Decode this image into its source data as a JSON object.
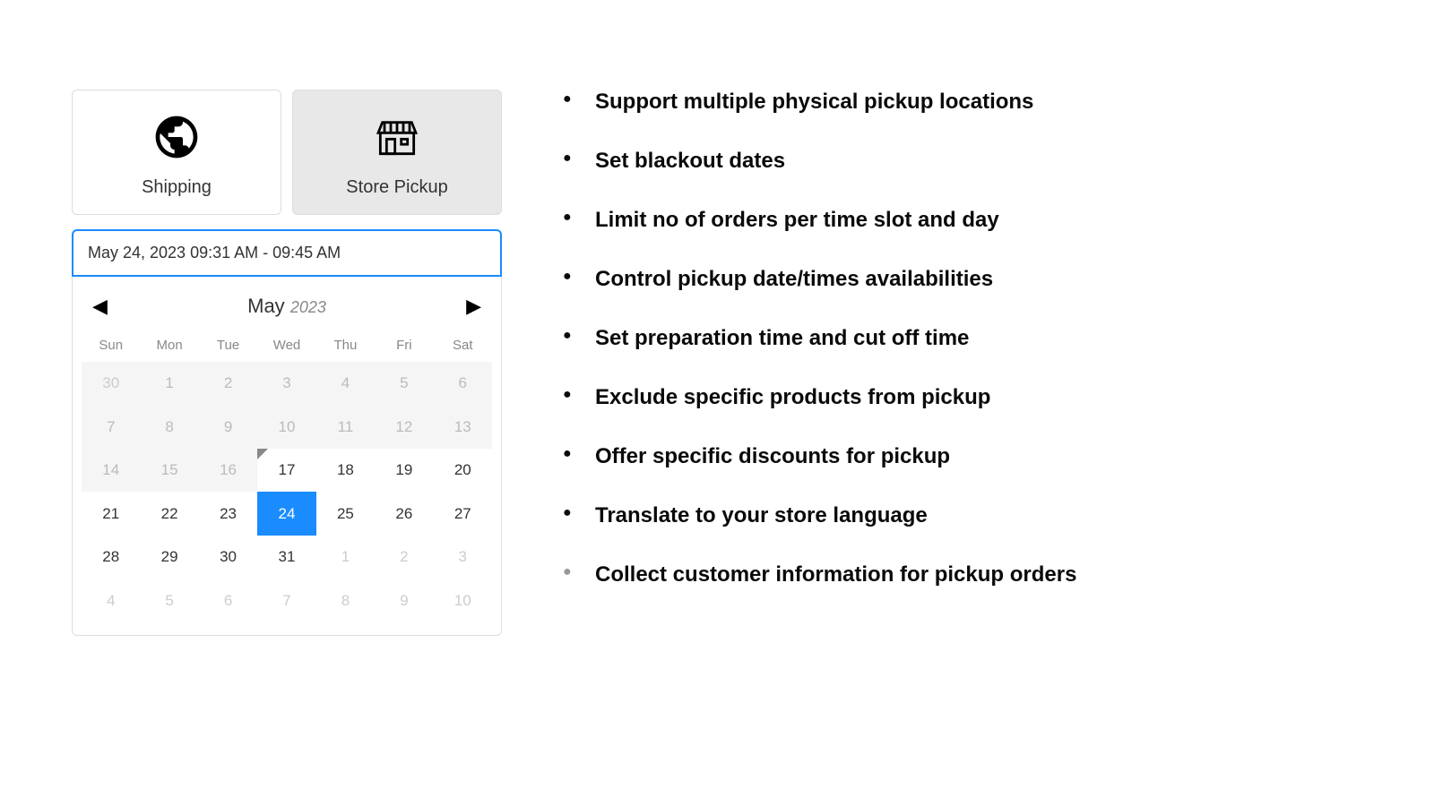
{
  "delivery": {
    "shipping_label": "Shipping",
    "pickup_label": "Store Pickup"
  },
  "datetime_input": {
    "value": "May 24, 2023 09:31 AM - 09:45 AM"
  },
  "calendar": {
    "month": "May",
    "year": "2023",
    "weekdays": [
      "Sun",
      "Mon",
      "Tue",
      "Wed",
      "Thu",
      "Fri",
      "Sat"
    ],
    "selected_day": 24,
    "days": [
      {
        "n": 30,
        "other": true,
        "disabled": true
      },
      {
        "n": 1,
        "disabled": true
      },
      {
        "n": 2,
        "disabled": true
      },
      {
        "n": 3,
        "disabled": true
      },
      {
        "n": 4,
        "disabled": true
      },
      {
        "n": 5,
        "disabled": true
      },
      {
        "n": 6,
        "disabled": true
      },
      {
        "n": 7,
        "disabled": true
      },
      {
        "n": 8,
        "disabled": true
      },
      {
        "n": 9,
        "disabled": true
      },
      {
        "n": 10,
        "disabled": true
      },
      {
        "n": 11,
        "disabled": true
      },
      {
        "n": 12,
        "disabled": true
      },
      {
        "n": 13,
        "disabled": true
      },
      {
        "n": 14,
        "disabled": true
      },
      {
        "n": 15,
        "disabled": true
      },
      {
        "n": 16,
        "disabled": true
      },
      {
        "n": 17,
        "today_corner": true
      },
      {
        "n": 18
      },
      {
        "n": 19
      },
      {
        "n": 20
      },
      {
        "n": 21
      },
      {
        "n": 22
      },
      {
        "n": 23
      },
      {
        "n": 24,
        "selected": true
      },
      {
        "n": 25
      },
      {
        "n": 26
      },
      {
        "n": 27
      },
      {
        "n": 28
      },
      {
        "n": 29
      },
      {
        "n": 30
      },
      {
        "n": 31
      },
      {
        "n": 1,
        "other": true
      },
      {
        "n": 2,
        "other": true
      },
      {
        "n": 3,
        "other": true
      },
      {
        "n": 4,
        "other": true
      },
      {
        "n": 5,
        "other": true
      },
      {
        "n": 6,
        "other": true
      },
      {
        "n": 7,
        "other": true
      },
      {
        "n": 8,
        "other": true
      },
      {
        "n": 9,
        "other": true
      },
      {
        "n": 10,
        "other": true
      }
    ]
  },
  "features": [
    {
      "text": "Support multiple physical pickup locations"
    },
    {
      "text": "Set blackout dates"
    },
    {
      "text": "Limit no of orders per time slot and day"
    },
    {
      "text": "Control pickup date/times availabilities"
    },
    {
      "text": "Set preparation time and cut off time"
    },
    {
      "text": "Exclude specific products from pickup"
    },
    {
      "text": "Offer specific discounts for pickup"
    },
    {
      "text": "Translate to your store language"
    },
    {
      "text": "Collect customer information for pickup orders",
      "faded": true
    }
  ]
}
